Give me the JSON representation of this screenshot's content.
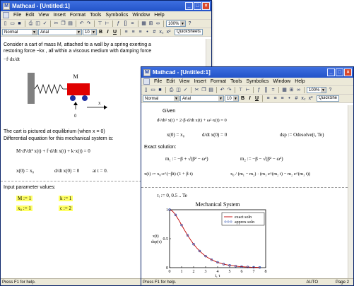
{
  "colors": {
    "title_bar": "#2353c8",
    "menu_bg": "#ece9d8",
    "highlight": "#ffff66",
    "cart": "#e00000",
    "wall": "#808080",
    "curve": "#c00000",
    "points": "#1a3fa8"
  },
  "window1": {
    "title": "Mathcad - [Untitled:1]",
    "menu": [
      "File",
      "Edit",
      "View",
      "Insert",
      "Format",
      "Tools",
      "Symbolics",
      "Window",
      "Help"
    ],
    "zoom": "100%",
    "style": "Normal",
    "font": "Arial",
    "size": "10",
    "format_buttons": [
      "B",
      "I",
      "U"
    ],
    "quicksheets": "QuickSheets",
    "intro_line1": "Consider a cart of mass M, attached to a wall by a spring exerting a",
    "intro_line2": "restoring force −kx , all within a viscous medium with damping force",
    "intro_damp": "−f·dx/dt",
    "label_m": "M",
    "label_x": "x",
    "label_zero": "0",
    "equilibrium": "The cart is pictured at equilibrium (when x = 0)",
    "diffeq_intro": "Differential equation for this mechanical system is:",
    "diffeq": "M·d²/dt² x(t) + f·d/dt x(t) + k·x(t) = 0",
    "ic1": "x(0) = x₀",
    "ic2": "d/dt x(0) = 0",
    "ic3": "at t = 0.",
    "params_title": "Input parameter values:",
    "p_m": "M := 1",
    "p_k": "k := 1",
    "p_x0": "x₀ := 1",
    "p_c": "c := 2",
    "status": "Press F1 for help."
  },
  "window2": {
    "title": "Mathcad - [Untitled:1]",
    "menu": [
      "File",
      "Edit",
      "View",
      "Insert",
      "Format",
      "Tools",
      "Symbolics",
      "Window",
      "Help"
    ],
    "zoom": "100%",
    "style": "Normal",
    "font": "Arial",
    "size": "10",
    "format_buttons": [
      "B",
      "I",
      "U"
    ],
    "quicksheets": "QuickShe",
    "given": "Given",
    "ode": "d²/dt² x(t) + 2·β·d/dt x(t) + ω²·x(t) = 0",
    "ic_a": "x(0) = x₀",
    "ic_b": "d/dt x(0) = 0",
    "odesolve": "dsp := Odesolve(t, Te)",
    "exact_title": "Exact solution:",
    "m1": "m₁ := −β + √(β² − ω²)",
    "m2": "m₂ := −β − √(β² − ω²)",
    "xt": "x(t) := x₀·e^(−βt)·(1 + β·t)",
    "xt_tail": "x₀ / (m₁ − m₂) · (m₁ e^(m₂ t) − m₂ e^(m₁ t))",
    "tau": "τᵢ := 0, 0.5 .. Te",
    "status": "Press F1 for help.",
    "status_mode": "AUTO",
    "status_page": "Page 2"
  },
  "chart_data": {
    "type": "line",
    "title": "Mechanical System",
    "xlabel": "t, τ",
    "ylabel": "x(t)",
    "ylabel2": "dsp(τ)",
    "xlim": [
      0,
      8
    ],
    "ylim": [
      0,
      1
    ],
    "x_ticks": [
      "0",
      "1",
      "2",
      "3",
      "4",
      "5",
      "6",
      "7",
      "8"
    ],
    "y_ticks": [
      "0",
      "0.5",
      "1"
    ],
    "legend_position": "top-right",
    "series": [
      {
        "name": "exact soln",
        "style": "line",
        "x": [
          0,
          0.25,
          0.5,
          0.75,
          1,
          1.25,
          1.5,
          1.75,
          2,
          2.25,
          2.5,
          2.75,
          3,
          3.25,
          3.5,
          3.75,
          4,
          4.25,
          4.5,
          4.75,
          5,
          5.25,
          5.5,
          5.75,
          6,
          6.25,
          6.5,
          6.75,
          7,
          7.25,
          7.5
        ],
        "values": [
          1,
          0.974,
          0.91,
          0.827,
          0.736,
          0.645,
          0.558,
          0.478,
          0.406,
          0.342,
          0.287,
          0.24,
          0.199,
          0.165,
          0.136,
          0.112,
          0.092,
          0.075,
          0.061,
          0.05,
          0.04,
          0.033,
          0.027,
          0.021,
          0.017,
          0.014,
          0.011,
          0.009,
          0.007,
          0.006,
          0.004
        ]
      },
      {
        "name": "approx soln",
        "style": "points",
        "x": [
          0,
          0.5,
          1,
          1.5,
          2,
          2.5,
          3,
          3.5,
          4,
          4.5,
          5,
          5.5,
          6,
          6.5,
          7,
          7.5
        ],
        "values": [
          1,
          0.91,
          0.736,
          0.558,
          0.406,
          0.287,
          0.199,
          0.136,
          0.092,
          0.061,
          0.04,
          0.027,
          0.017,
          0.011,
          0.007,
          0.004
        ]
      }
    ]
  }
}
